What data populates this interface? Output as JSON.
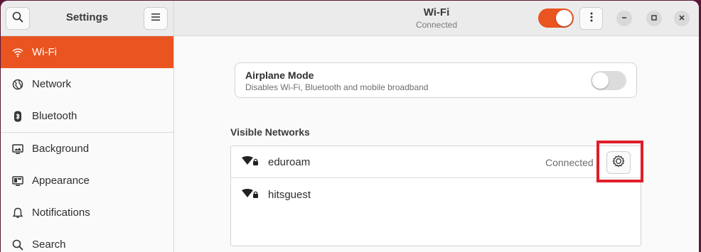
{
  "sidebar_header": {
    "title": "Settings",
    "search_icon": "search-icon",
    "menu_icon": "hamburger-menu-icon"
  },
  "main_header": {
    "title": "Wi-Fi",
    "subtitle": "Connected",
    "wifi_toggle_on": true,
    "window_controls": [
      "minimize",
      "maximize",
      "close"
    ]
  },
  "sidebar": {
    "items": [
      {
        "label": "Wi-Fi",
        "icon": "wifi-icon",
        "active": true
      },
      {
        "label": "Network",
        "icon": "globe-icon",
        "active": false
      },
      {
        "label": "Bluetooth",
        "icon": "bluetooth-icon",
        "active": false
      },
      {
        "label": "Background",
        "icon": "monitor-icon",
        "active": false
      },
      {
        "label": "Appearance",
        "icon": "appearance-icon",
        "active": false
      },
      {
        "label": "Notifications",
        "icon": "bell-icon",
        "active": false
      },
      {
        "label": "Search",
        "icon": "search-icon",
        "active": false
      }
    ]
  },
  "airplane": {
    "title": "Airplane Mode",
    "subtitle": "Disables Wi-Fi, Bluetooth and mobile broadband",
    "enabled": false
  },
  "networks": {
    "section_title": "Visible Networks",
    "items": [
      {
        "name": "eduroam",
        "status": "Connected",
        "secured": true
      },
      {
        "name": "hitsguest",
        "status": "",
        "secured": true
      }
    ]
  },
  "colors": {
    "accent": "#e95420",
    "highlight": "#e01e2a"
  }
}
